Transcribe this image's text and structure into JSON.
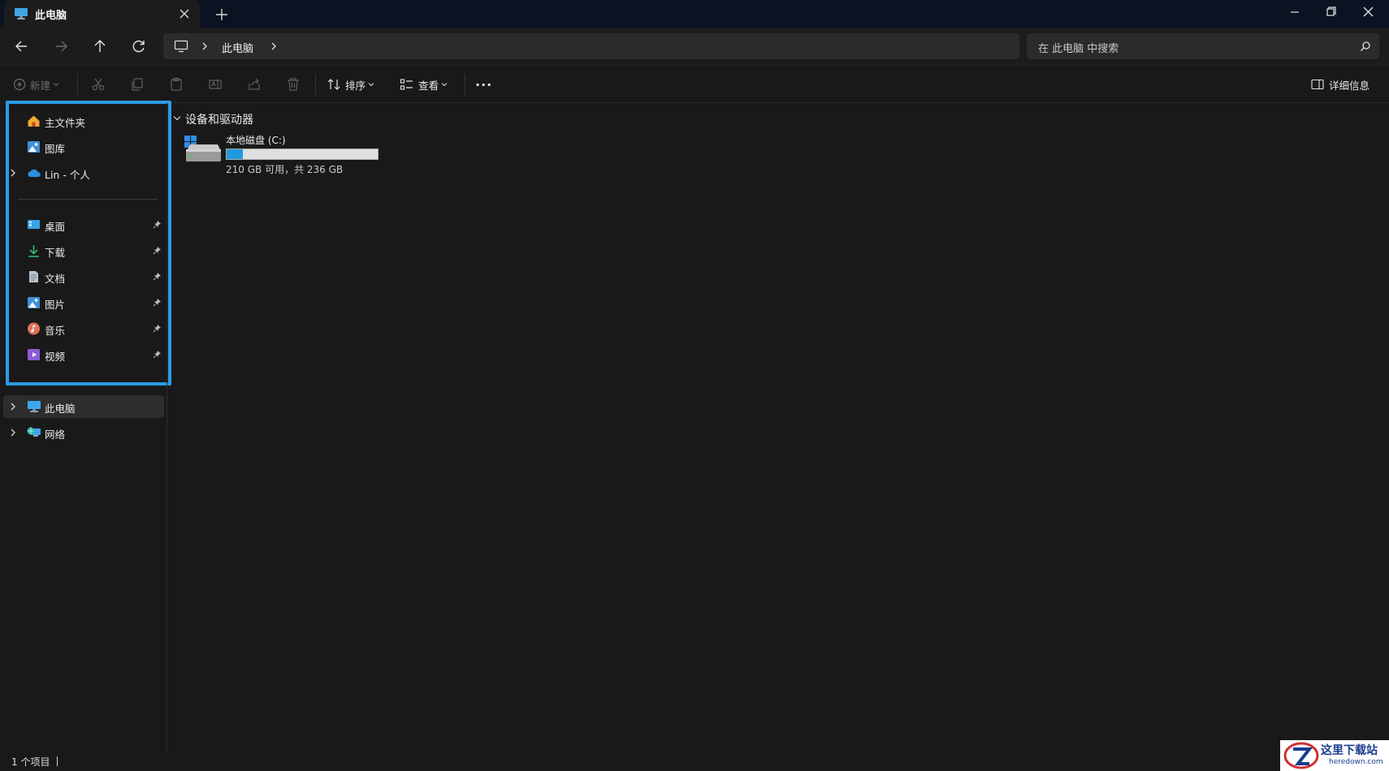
{
  "window": {
    "tab_title": "此电脑",
    "new_tab_symbol": "+",
    "icons": {
      "tab": "monitor-icon",
      "close": "close-icon",
      "minimize": "minimize-icon",
      "maximize": "restore-icon",
      "window_close": "close-icon"
    }
  },
  "nav": {
    "breadcrumb": "此电脑",
    "search_placeholder": "在 此电脑 中搜索",
    "icons": [
      "back-arrow-icon",
      "forward-arrow-icon",
      "up-arrow-icon",
      "refresh-icon"
    ]
  },
  "toolbar": {
    "new_label": "新建",
    "sort_label": "排序",
    "view_label": "查看",
    "more_label": "···",
    "details_label": "详细信息"
  },
  "sidebar": {
    "top_items": [
      {
        "label": "主文件夹",
        "icon": "home-icon"
      },
      {
        "label": "图库",
        "icon": "gallery-icon"
      },
      {
        "label": "Lin - 个人",
        "icon": "onedrive-cloud-icon",
        "expandable": true
      }
    ],
    "pinned_items": [
      {
        "label": "桌面",
        "icon": "desktop-icon"
      },
      {
        "label": "下载",
        "icon": "download-icon"
      },
      {
        "label": "文档",
        "icon": "document-icon"
      },
      {
        "label": "图片",
        "icon": "pictures-icon"
      },
      {
        "label": "音乐",
        "icon": "music-icon"
      },
      {
        "label": "视频",
        "icon": "video-icon"
      }
    ],
    "bottom_items": [
      {
        "label": "此电脑",
        "icon": "monitor-icon",
        "selected": true
      },
      {
        "label": "网络",
        "icon": "network-icon"
      }
    ]
  },
  "content": {
    "section_title": "设备和驱动器",
    "drive": {
      "name": "本地磁盘 (C:)",
      "free_text": "210 GB 可用，共 236 GB",
      "used_fraction": 0.11
    }
  },
  "status": {
    "item_count": "1 个项目"
  },
  "watermark": {
    "text": "这里下载站",
    "url": "heredown.com"
  },
  "colors": {
    "accent": "#2b9be8",
    "drive_fill": "#1e9bdf",
    "titlebar": "#0b1221"
  }
}
